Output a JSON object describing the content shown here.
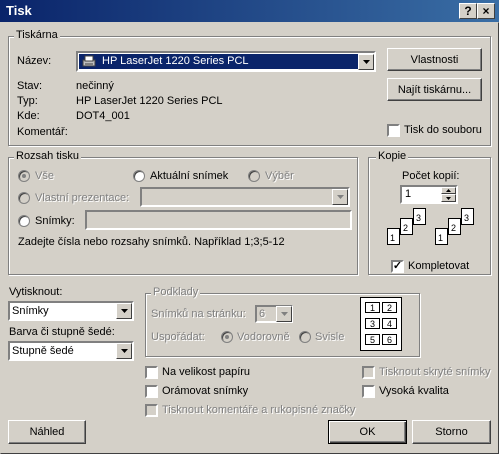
{
  "window": {
    "title": "Tisk",
    "help_label": "?",
    "close_label": "×"
  },
  "printer": {
    "group_title": "Tiskárna",
    "name_label": "Název:",
    "name_value": "HP LaserJet 1220 Series PCL",
    "status_label": "Stav:",
    "status_value": "nečinný",
    "type_label": "Typ:",
    "type_value": "HP LaserJet 1220 Series PCL",
    "where_label": "Kde:",
    "where_value": "DOT4_001",
    "comment_label": "Komentář:",
    "properties_button": "Vlastnosti",
    "find_printer_button": "Najít tiskárnu...",
    "print_to_file_label": "Tisk do souboru",
    "print_to_file_checked": false
  },
  "range": {
    "group_title": "Rozsah tisku",
    "all_label": "Vše",
    "current_slide_label": "Aktuální snímek",
    "selection_label": "Výběr",
    "custom_show_label": "Vlastní prezentace:",
    "slides_label": "Snímky:",
    "slides_value": "",
    "hint": "Zadejte čísla nebo rozsahy snímků. Například 1;3;5-12",
    "selected": "all"
  },
  "copies": {
    "group_title": "Kopie",
    "count_label": "Počet kopií:",
    "count_value": "1",
    "collate_label": "Kompletovat",
    "collate_checked": true,
    "page_digits": [
      "1",
      "2",
      "3"
    ]
  },
  "print_what": {
    "label": "Vytisknout:",
    "value": "Snímky"
  },
  "color": {
    "label": "Barva či stupně šedé:",
    "value": "Stupně šedé"
  },
  "handouts": {
    "group_title": "Podklady",
    "per_page_label": "Snímků na stránku:",
    "per_page_value": "6",
    "order_label": "Uspořádat:",
    "horizontal_label": "Vodorovně",
    "vertical_label": "Svisle",
    "preview_numbers": [
      "1",
      "2",
      "3",
      "4",
      "5",
      "6"
    ]
  },
  "options": {
    "scale_to_fit_label": "Na velikost papíru",
    "frame_slides_label": "Orámovat snímky",
    "print_comments_label": "Tisknout komentáře a rukopisné značky",
    "print_hidden_label": "Tisknout skryté snímky",
    "high_quality_label": "Vysoká kvalita"
  },
  "buttons": {
    "preview": "Náhled",
    "ok": "OK",
    "cancel": "Storno"
  }
}
